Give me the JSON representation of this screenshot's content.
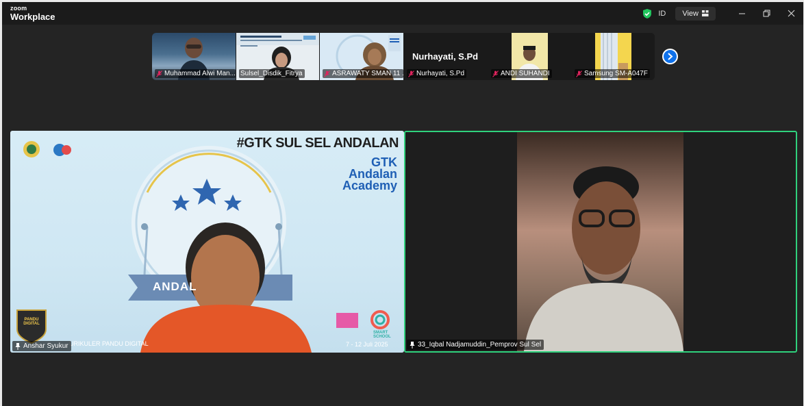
{
  "titlebar": {
    "brand_top": "zoom",
    "brand_bottom": "Workplace",
    "id_label": "ID",
    "view_label": "View",
    "security_color": "#22c55e"
  },
  "gallery": {
    "participants": [
      {
        "name": "Muhammad Alwi Man...",
        "muted": true
      },
      {
        "name": "Sulsel_Disdik_Fitrya",
        "muted": false
      },
      {
        "name": "ASRAWATY SMAN 11 ...",
        "muted": true
      },
      {
        "name": "Nurhayati, S.Pd",
        "muted": true,
        "display_name": "Nurhayati, S.Pd"
      },
      {
        "name": "ANDI SUHANDI",
        "muted": true
      },
      {
        "name": "Samsung SM-A047F",
        "muted": true
      }
    ],
    "next_icon": "chevron-right-icon"
  },
  "main": {
    "left": {
      "name": "Anshar Syukur",
      "banner_tag": "#GTK SUL SEL ANDALAN",
      "banner_title_1": "GTK",
      "banner_title_2": "Andalan",
      "banner_title_3": "Academy",
      "badge_text": "ANDAL",
      "bottom_text": "URIKULER PANDU DIGITAL",
      "date_text": "7 - 12 Juli 2025",
      "logo_text": "PANDU DIGITAL",
      "smart_school": "SMART SCHOOL",
      "accent_color": "#1f5fb5"
    },
    "right": {
      "name": "33_Iqbal Nadjamuddin_Pemprov Sul Sel",
      "active_speaker_color": "#2fd27d"
    }
  }
}
